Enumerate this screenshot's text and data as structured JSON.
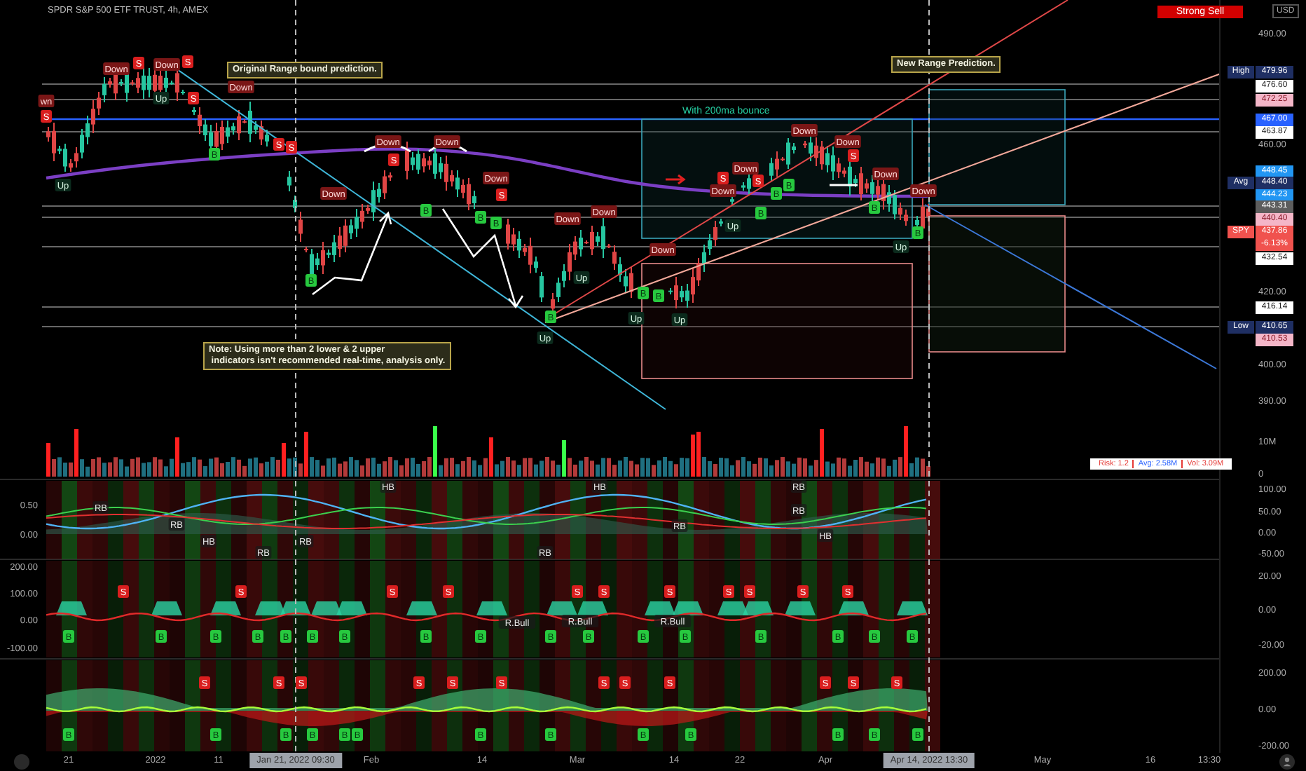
{
  "header": {
    "title": "SPDR S&P 500 ETF TRUST, 4h, AMEX",
    "signal": "Strong Sell",
    "currency": "USD"
  },
  "annotations": [
    {
      "kind": "note",
      "text": "Original Range bound prediction."
    },
    {
      "kind": "note",
      "text": "New Range Prediction."
    },
    {
      "kind": "note",
      "text": "Note: Using more than 2 lower & 2 upper\n indicators isn't recommended real-time, analysis only."
    },
    {
      "kind": "caption",
      "text": "With 200ma bounce"
    }
  ],
  "signals": [
    {
      "kind": "down",
      "label": "Down"
    },
    {
      "kind": "sell",
      "label": "S"
    },
    {
      "kind": "down",
      "label": "Down"
    },
    {
      "kind": "sell",
      "label": "S"
    },
    {
      "kind": "up",
      "label": "Up"
    },
    {
      "kind": "down",
      "label": "Down"
    },
    {
      "kind": "sell",
      "label": "S"
    },
    {
      "kind": "down",
      "label": "wn"
    },
    {
      "kind": "sell",
      "label": "S"
    },
    {
      "kind": "up",
      "label": "Up"
    },
    {
      "kind": "buy",
      "label": "B"
    },
    {
      "kind": "sell",
      "label": "S"
    },
    {
      "kind": "sell",
      "label": "S"
    },
    {
      "kind": "down",
      "label": "Down"
    },
    {
      "kind": "buy",
      "label": "B"
    },
    {
      "kind": "down",
      "label": "Down"
    },
    {
      "kind": "sell",
      "label": "S"
    },
    {
      "kind": "down",
      "label": "Down"
    },
    {
      "kind": "buy",
      "label": "B"
    },
    {
      "kind": "down",
      "label": "Down"
    },
    {
      "kind": "sell",
      "label": "S"
    },
    {
      "kind": "buy",
      "label": "B"
    },
    {
      "kind": "buy",
      "label": "B"
    },
    {
      "kind": "down",
      "label": "Down"
    },
    {
      "kind": "down",
      "label": "Down"
    },
    {
      "kind": "up",
      "label": "Up"
    },
    {
      "kind": "buy",
      "label": "B"
    },
    {
      "kind": "up",
      "label": "Up"
    },
    {
      "kind": "down",
      "label": "Down"
    },
    {
      "kind": "buy",
      "label": "B"
    },
    {
      "kind": "buy",
      "label": "B"
    },
    {
      "kind": "up",
      "label": "Up"
    },
    {
      "kind": "up",
      "label": "Up"
    },
    {
      "kind": "sell",
      "label": "S"
    },
    {
      "kind": "down",
      "label": "Down"
    },
    {
      "kind": "down",
      "label": "Down"
    },
    {
      "kind": "sell",
      "label": "S"
    },
    {
      "kind": "up",
      "label": "Up"
    },
    {
      "kind": "buy",
      "label": "B"
    },
    {
      "kind": "buy",
      "label": "B"
    },
    {
      "kind": "buy",
      "label": "B"
    },
    {
      "kind": "down",
      "label": "Down"
    },
    {
      "kind": "down",
      "label": "Down"
    },
    {
      "kind": "sell",
      "label": "S"
    },
    {
      "kind": "down",
      "label": "Down"
    },
    {
      "kind": "buy",
      "label": "B"
    },
    {
      "kind": "down",
      "label": "Down"
    },
    {
      "kind": "up",
      "label": "Up"
    },
    {
      "kind": "buy",
      "label": "B"
    }
  ],
  "price_axis": {
    "ticks": [
      "490.00",
      "460.00",
      "420.00",
      "400.00",
      "390.00"
    ],
    "labels": [
      {
        "tag": "High",
        "value": "479.96",
        "color": "#1f2f63"
      },
      {
        "value": "476.60",
        "color": "#ffffff"
      },
      {
        "value": "472.25",
        "color": "#f4b6c8"
      },
      {
        "value": "467.00",
        "color": "#2962ff"
      },
      {
        "value": "463.87",
        "color": "#ffffff"
      },
      {
        "value": "448.45",
        "color": "#2196f3"
      },
      {
        "tag": "Avg",
        "value": "448.40",
        "color": "#1f2f63"
      },
      {
        "value": "444.23",
        "color": "#2196f3"
      },
      {
        "value": "443.31",
        "color": "#5d5d5d"
      },
      {
        "value": "440.40",
        "color": "#f4b6c8"
      },
      {
        "tag": "SPY",
        "value": "437.86",
        "change": "-6.13%",
        "color": "#f0524e"
      },
      {
        "value": "432.54",
        "color": "#ffffff"
      },
      {
        "value": "416.14",
        "color": "#ffffff"
      },
      {
        "tag": "Low",
        "value": "410.65",
        "color": "#1f2f63"
      },
      {
        "value": "410.53",
        "color": "#f4b6c8"
      }
    ]
  },
  "volume": {
    "ticks": [
      "10M",
      "0"
    ],
    "legend": [
      {
        "text": "Risk: 1.2",
        "color": "#e53935"
      },
      {
        "text": "Avg: 2.58M",
        "color": "#2962ff"
      },
      {
        "text": "Vol: 3.09M",
        "color": "#e53935"
      }
    ]
  },
  "panes": [
    {
      "left_ticks": [
        "0.50",
        "0.00"
      ],
      "right_ticks": [
        "100.00",
        "50.00",
        "0.00",
        "-50.00"
      ],
      "labels": [
        {
          "kind": "text",
          "label": "RB"
        },
        {
          "kind": "text",
          "label": "RB"
        },
        {
          "kind": "text",
          "label": "HB"
        },
        {
          "kind": "text",
          "label": "RB"
        },
        {
          "kind": "text",
          "label": "RB"
        },
        {
          "kind": "text",
          "label": "HB"
        },
        {
          "kind": "text",
          "label": "RB"
        },
        {
          "kind": "text",
          "label": "HB"
        },
        {
          "kind": "text",
          "label": "RB"
        },
        {
          "kind": "text",
          "label": "RB"
        },
        {
          "kind": "text",
          "label": "RB"
        },
        {
          "kind": "text",
          "label": "HB"
        }
      ]
    },
    {
      "left_ticks": [
        "200.00",
        "100.00",
        "0.00",
        "-100.00"
      ],
      "right_ticks": [
        "20.00",
        "0.00",
        "-20.00"
      ],
      "labels": [
        {
          "kind": "sell",
          "label": "S"
        },
        {
          "kind": "sell",
          "label": "S"
        },
        {
          "kind": "sell",
          "label": "S"
        },
        {
          "kind": "sell",
          "label": "S"
        },
        {
          "kind": "sell",
          "label": "S"
        },
        {
          "kind": "sell",
          "label": "S"
        },
        {
          "kind": "sell",
          "label": "S"
        },
        {
          "kind": "sell",
          "label": "S"
        },
        {
          "kind": "sell",
          "label": "S"
        },
        {
          "kind": "sell",
          "label": "S"
        },
        {
          "kind": "sell",
          "label": "S"
        },
        {
          "kind": "buy",
          "label": "B"
        },
        {
          "kind": "buy",
          "label": "B"
        },
        {
          "kind": "buy",
          "label": "B"
        },
        {
          "kind": "buy",
          "label": "B"
        },
        {
          "kind": "buy",
          "label": "B"
        },
        {
          "kind": "buy",
          "label": "B"
        },
        {
          "kind": "buy",
          "label": "B"
        },
        {
          "kind": "buy",
          "label": "B"
        },
        {
          "kind": "buy",
          "label": "B"
        },
        {
          "kind": "buy",
          "label": "B"
        },
        {
          "kind": "buy",
          "label": "B"
        },
        {
          "kind": "buy",
          "label": "B"
        },
        {
          "kind": "buy",
          "label": "B"
        },
        {
          "kind": "buy",
          "label": "B"
        },
        {
          "kind": "buy",
          "label": "B"
        },
        {
          "kind": "buy",
          "label": "B"
        },
        {
          "kind": "buy",
          "label": "B"
        },
        {
          "kind": "text",
          "label": "R.Bull"
        },
        {
          "kind": "text",
          "label": "R.Bull"
        },
        {
          "kind": "text",
          "label": "R.Bull"
        }
      ]
    },
    {
      "right_ticks": [
        "200.00",
        "0.00",
        "-200.00"
      ],
      "labels": [
        {
          "kind": "sell",
          "label": "S"
        },
        {
          "kind": "sell",
          "label": "S"
        },
        {
          "kind": "sell",
          "label": "S"
        },
        {
          "kind": "sell",
          "label": "S"
        },
        {
          "kind": "sell",
          "label": "S"
        },
        {
          "kind": "sell",
          "label": "S"
        },
        {
          "kind": "sell",
          "label": "S"
        },
        {
          "kind": "sell",
          "label": "S"
        },
        {
          "kind": "sell",
          "label": "S"
        },
        {
          "kind": "sell",
          "label": "S"
        },
        {
          "kind": "sell",
          "label": "S"
        },
        {
          "kind": "sell",
          "label": "S"
        },
        {
          "kind": "buy",
          "label": "B"
        },
        {
          "kind": "buy",
          "label": "B"
        },
        {
          "kind": "buy",
          "label": "B"
        },
        {
          "kind": "buy",
          "label": "B"
        },
        {
          "kind": "buy",
          "label": "B"
        },
        {
          "kind": "buy",
          "label": "B"
        },
        {
          "kind": "buy",
          "label": "B"
        },
        {
          "kind": "buy",
          "label": "B"
        },
        {
          "kind": "buy",
          "label": "B"
        },
        {
          "kind": "buy",
          "label": "B"
        },
        {
          "kind": "buy",
          "label": "B"
        },
        {
          "kind": "buy",
          "label": "B"
        },
        {
          "kind": "buy",
          "label": "B"
        }
      ]
    }
  ],
  "time_axis": [
    {
      "kind": "tick",
      "text": "21"
    },
    {
      "kind": "tick",
      "text": "2022"
    },
    {
      "kind": "tick",
      "text": "11"
    },
    {
      "kind": "cursor",
      "text": "Jan 21, 2022 09:30"
    },
    {
      "kind": "tick",
      "text": "Feb"
    },
    {
      "kind": "tick",
      "text": "14"
    },
    {
      "kind": "tick",
      "text": "Mar"
    },
    {
      "kind": "tick",
      "text": "14"
    },
    {
      "kind": "tick",
      "text": "22"
    },
    {
      "kind": "tick",
      "text": "Apr"
    },
    {
      "kind": "cursor",
      "text": "Apr 14, 2022 13:30"
    },
    {
      "kind": "tick",
      "text": "May"
    },
    {
      "kind": "tick",
      "text": "16"
    },
    {
      "kind": "tick",
      "text": "13:30"
    }
  ]
}
